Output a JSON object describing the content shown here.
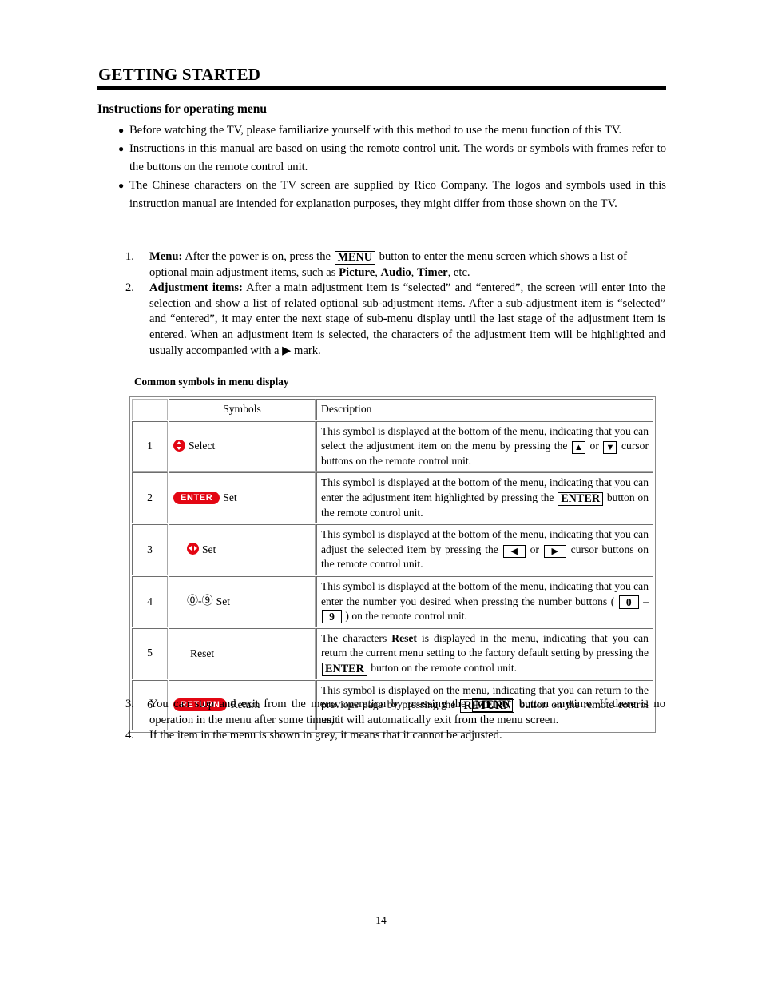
{
  "document": {
    "chapter_title": "GETTING STARTED",
    "section_heading": "Instructions for operating menu",
    "page_number": "14"
  },
  "bullets": [
    {
      "marker": "●",
      "text": "Before watching the TV, please familiarize yourself with this method to use the menu function of this TV."
    },
    {
      "marker": "●",
      "text": "Instructions in this manual are based on using the remote control unit. The words or symbols with frames refer to the buttons on the remote control unit."
    },
    {
      "marker": "●",
      "text": "The Chinese characters on the TV screen are supplied by Rico Company. The logos and symbols used in this instruction manual are intended for explanation purposes, they might differ from those shown on the TV."
    }
  ],
  "steps_top": [
    {
      "index": "1.",
      "lead": "Menu:",
      "part1": " After the power is on, press the ",
      "key": "MENU",
      "part2": " button to enter the menu screen which shows a list of optional main adjustment items, such as ",
      "emph1": "Picture",
      "sep1": ", ",
      "emph2": "Audio",
      "sep2": ", ",
      "emph3": "Timer",
      "tail": ", etc."
    },
    {
      "index": "2.",
      "lead": "Adjustment items:",
      "body": " After a main adjustment item is “selected” and “entered”, the screen will enter into the selection and show a list of related optional sub-adjustment items. After a sub-adjustment item is “selected” and “entered”, it may enter the next stage of sub-menu display until the last stage of the adjustment item is entered. When an adjustment item is selected, the characters of the adjustment item will be highlighted and usually accompanied with a ▶ mark."
    }
  ],
  "table": {
    "caption": "Common symbols in menu display",
    "headers": {
      "index": "",
      "symbols": "Symbols",
      "description": "Description"
    },
    "rows": [
      {
        "index": "1",
        "symbol_kind": "red-circle-updown",
        "symbol_label": "Select",
        "desc_pre": "This symbol is displayed at the bottom of the menu, indicating that you can select the adjustment item on the menu by pressing the ",
        "key1": "▲",
        "desc_mid": " or ",
        "key2": "▼",
        "desc_post": " cursor buttons on the remote control unit."
      },
      {
        "index": "2",
        "symbol_kind": "red-pill",
        "symbol_badge": "ENTER",
        "symbol_label": "Set",
        "desc_pre": "This symbol is displayed at the bottom of the menu, indicating that you can enter the adjustment item highlighted by pressing the ",
        "key1": "ENTER",
        "desc_post": " button on the remote control unit."
      },
      {
        "index": "3",
        "symbol_kind": "red-circle-leftright",
        "symbol_label": "Set",
        "desc_pre": "This symbol is displayed at the bottom of the menu, indicating that you can adjust the selected item by pressing the ",
        "key1": "◀",
        "desc_mid": " or ",
        "key2": "▶",
        "desc_post": " cursor buttons on the remote control unit."
      },
      {
        "index": "4",
        "symbol_kind": "circled-digits",
        "symbol_digits": "⓪-⑨",
        "symbol_label": "Set",
        "desc_pre": "This symbol is displayed at the bottom of the menu, indicating that you can enter the number you desired when pressing the number buttons ( ",
        "key1": "0",
        "desc_mid": " – ",
        "key2": "9",
        "desc_post": " ) on the remote control unit."
      },
      {
        "index": "5",
        "symbol_kind": "plain-text",
        "symbol_label": "Reset",
        "desc_pre": "The characters ",
        "desc_bold": "Reset",
        "desc_mid": " is displayed in the menu, indicating that you can return the current menu setting to the factory default setting by pressing the ",
        "key1": "ENTER",
        "desc_post": " button on the remote control unit."
      },
      {
        "index": "6",
        "symbol_kind": "red-pill",
        "symbol_badge": "RETURN",
        "symbol_label": "Return",
        "desc_pre": "This symbol is displayed on the menu, indicating that you can return to the previous page by pressing the ",
        "key1": "RETURN",
        "desc_post": " button on the remote control unit."
      }
    ]
  },
  "steps_bottom": [
    {
      "index": "3.",
      "part1": "You can stop and exit from the menu operation by pressing the ",
      "key": "MENU",
      "part2": " button anytime. If there is no operation in the menu after some times, it will automatically exit from the menu screen."
    },
    {
      "index": "4.",
      "part1": "If the item in the menu is shown in grey, it means that it cannot be adjusted.",
      "key": "",
      "part2": ""
    }
  ],
  "colors": {
    "accent_red": "#e30613",
    "rule_black": "#000000"
  }
}
